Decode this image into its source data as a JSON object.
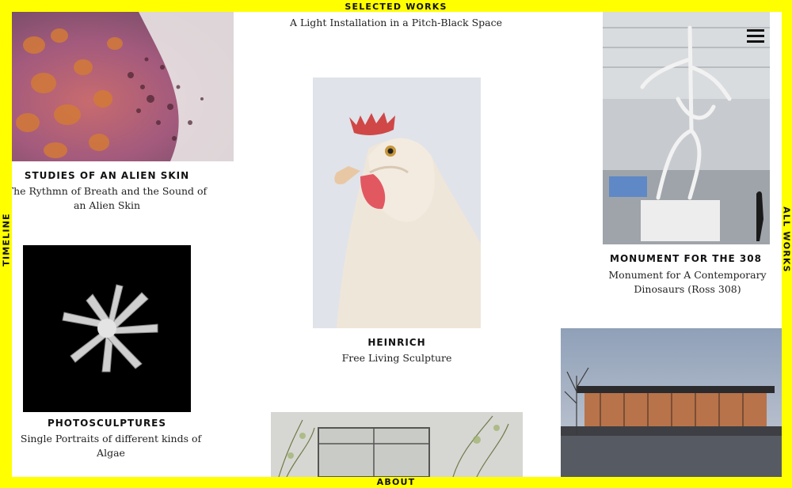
{
  "nav": {
    "top": "SELECTED WORKS",
    "bottom": "ABOUT",
    "left": "TIMELINE",
    "right": "ALL WORKS"
  },
  "works": {
    "light": {
      "subtitle": "A Light Installation in a Pitch-Black Space"
    },
    "alien": {
      "title": "STUDIES OF AN ALIEN SKIN",
      "subtitle": "The Rythmn of Breath and the Sound of an Alien Skin"
    },
    "heinrich": {
      "title": "HEINRICH",
      "subtitle": "Free Living Sculpture"
    },
    "monument": {
      "title": "MONUMENT FOR THE 308",
      "subtitle": "Monument for A Contemporary Dinosaurs (Ross 308)"
    },
    "photo": {
      "title": "PHOTOSCULPTURES",
      "subtitle": "Single Portraits of different kinds of Algae"
    }
  },
  "colors": {
    "frame": "#ffff00",
    "background": "#ffffff",
    "text": "#111111"
  },
  "icons": {
    "menu": "hamburger-menu-icon"
  }
}
